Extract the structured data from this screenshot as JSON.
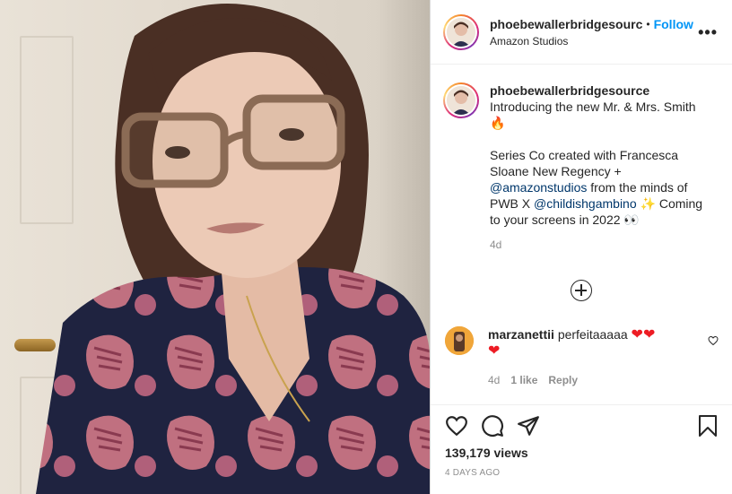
{
  "post": {
    "username": "phoebewallerbridgesourc",
    "separator": "•",
    "follow_label": "Follow",
    "location": "Amazon Studios",
    "more_label": "•••"
  },
  "caption": {
    "username": "phoebewallerbridgesource",
    "line1": "Introducing the new Mr. & Mrs. Smith",
    "fire_emoji": "🔥",
    "body_start": "Series Co created with Francesca Sloane New Regency +",
    "mention1": "@amazonstudios",
    "body_mid": "from the minds of PWB X",
    "mention2": "@childishgambino",
    "sparkle_emoji": "✨",
    "body_end": "Coming to your screens in 2022",
    "eyes_emoji": "👀",
    "time": "4d"
  },
  "comment": {
    "username": "marzanettii",
    "text": "perfeitaaaaa",
    "hearts": "❤❤",
    "heart2": "❤",
    "time": "4d",
    "likes": "1 like",
    "reply": "Reply"
  },
  "stats": {
    "views": "139,179 views",
    "posted_ago": "4 DAYS AGO"
  },
  "icons": {
    "like": "heart-icon",
    "comment": "comment-icon",
    "share": "share-icon",
    "save": "bookmark-icon",
    "add_comment": "plus-circle-icon"
  },
  "colors": {
    "accent": "#0095f6",
    "mention": "#00376b",
    "muted": "#8e8e8e",
    "heart": "#ed1c24"
  }
}
